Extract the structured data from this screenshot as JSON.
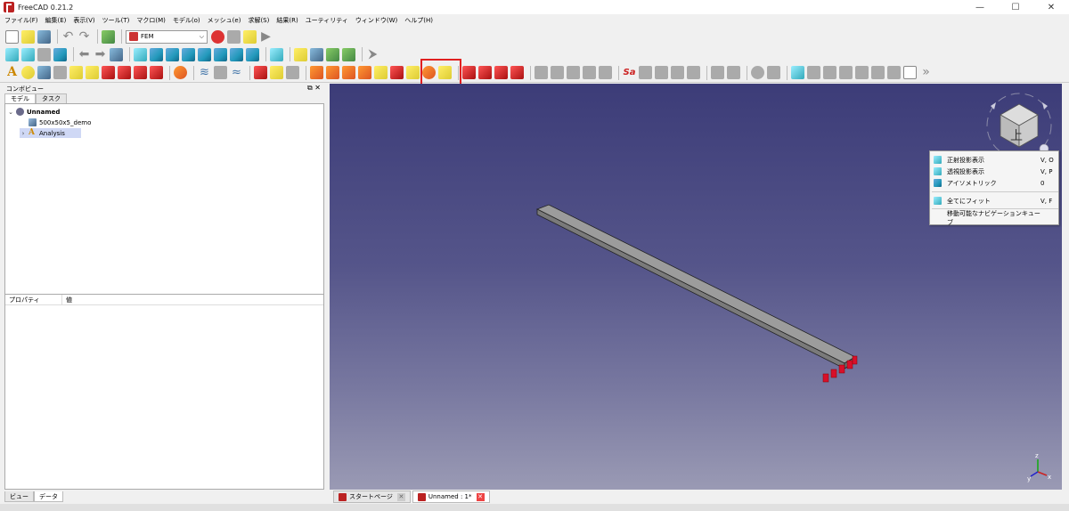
{
  "window": {
    "title": "FreeCAD 0.21.2",
    "minimize": "—",
    "maximize": "☐",
    "close": "✕"
  },
  "menu": [
    "ファイル(F)",
    "編集(E)",
    "表示(V)",
    "ツール(T)",
    "マクロ(M)",
    "モデル(o)",
    "メッシュ(e)",
    "求解(S)",
    "結果(R)",
    "ユーティリティ",
    "ウィンドウ(W)",
    "ヘルプ(H)"
  ],
  "workbench": {
    "selected": "FEM"
  },
  "combo_view": {
    "title": "コンボビュー",
    "tabs": [
      "モデル",
      "タスク"
    ],
    "tree": [
      {
        "label": "Unnamed",
        "level": 0
      },
      {
        "label": "500x50x5_demo",
        "level": 1
      },
      {
        "label": "Analysis",
        "level": 1
      }
    ],
    "property_headers": [
      "プロパティ",
      "値"
    ],
    "bottom_tabs": [
      "ビュー",
      "データ"
    ]
  },
  "doc_tabs": [
    {
      "label": "スタートページ"
    },
    {
      "label": "Unnamed : 1*"
    }
  ],
  "context_menu": [
    {
      "label": "正射投影表示",
      "shortcut": "V, O",
      "icon": "orthographic-icon"
    },
    {
      "label": "透視投影表示",
      "shortcut": "V, P",
      "icon": "perspective-icon"
    },
    {
      "label": "アイソメトリック",
      "shortcut": "0",
      "icon": "isometric-icon"
    },
    {
      "label": "全てにフィット",
      "shortcut": "V, F",
      "icon": "fit-all-icon"
    },
    {
      "label": "移動可能なナビゲーションキューブ",
      "shortcut": "",
      "icon": ""
    }
  ],
  "navcube": {
    "face_label": "上"
  },
  "axis_labels": {
    "x": "x",
    "y": "y",
    "z": "z"
  },
  "colors": {
    "viewport_top": "#3c3c78",
    "viewport_bottom": "#9a9ab4",
    "highlight": "#e02020",
    "annotation_arrow": "#e8752a",
    "constraint": "#d8102a"
  }
}
